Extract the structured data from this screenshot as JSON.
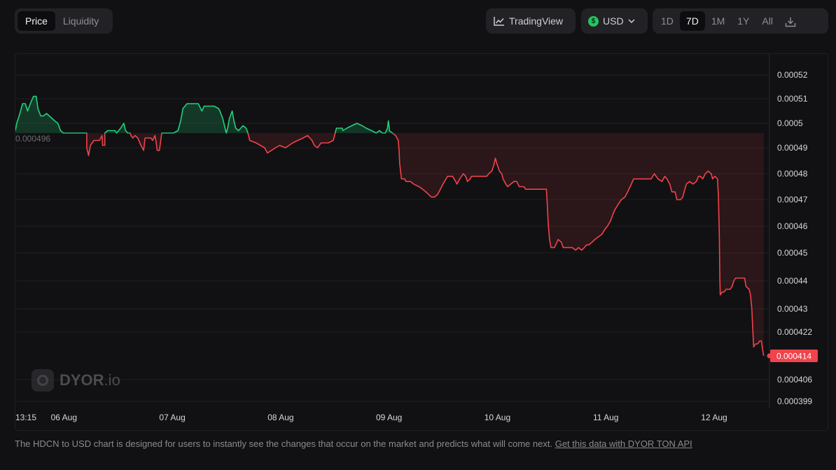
{
  "toolbar": {
    "tabs": [
      {
        "label": "Price",
        "active": true
      },
      {
        "label": "Liquidity",
        "active": false
      }
    ],
    "tradingview_label": "TradingView",
    "currency": {
      "label": "USD",
      "icon": "$"
    },
    "ranges": [
      {
        "label": "1D"
      },
      {
        "label": "7D",
        "active": true
      },
      {
        "label": "1M"
      },
      {
        "label": "1Y"
      },
      {
        "label": "All"
      }
    ],
    "download_icon": "download-icon"
  },
  "watermark": {
    "brand": "DYOR",
    ".suffix": ".io",
    "suffix": ".io"
  },
  "footer": {
    "text": "The HDCN to USD chart is designed for users to instantly see the changes that occur on the market and predicts what will come next. ",
    "link": "Get this data with DYOR TON API"
  },
  "colors": {
    "up": "#22d17a",
    "down": "#f0434b",
    "grid": "#1e1e22",
    "axis_text": "#d8d8dc",
    "baseline_text": "#6b6b72"
  },
  "chart_data": {
    "type": "line",
    "baseline": 0.000496,
    "baseline_label": "0.000496",
    "last_value": 0.000414,
    "last_label": "0.000414",
    "y_ticks": [
      {
        "label": "0.00052",
        "v": 0.00052
      },
      {
        "label": "0.00051",
        "v": 0.00051
      },
      {
        "label": "0.0005",
        "v": 0.0005
      },
      {
        "label": "0.00049",
        "v": 0.00049
      },
      {
        "label": "0.00048",
        "v": 0.00048
      },
      {
        "label": "0.00047",
        "v": 0.00047
      },
      {
        "label": "0.00046",
        "v": 0.00046
      },
      {
        "label": "0.00045",
        "v": 0.00045
      },
      {
        "label": "0.00044",
        "v": 0.00044
      },
      {
        "label": "0.00043",
        "v": 0.00043
      },
      {
        "label": "0.000422",
        "v": 0.000422
      },
      {
        "label": "0.000406",
        "v": 0.000406
      },
      {
        "label": "0.000399",
        "v": 0.000399
      }
    ],
    "x_ticks": [
      {
        "label": "13:15",
        "t": 0
      },
      {
        "label": "06 Aug",
        "t": 10.75
      },
      {
        "label": "07 Aug",
        "t": 34.75
      },
      {
        "label": "08 Aug",
        "t": 58.75
      },
      {
        "label": "09 Aug",
        "t": 82.75
      },
      {
        "label": "10 Aug",
        "t": 106.75
      },
      {
        "label": "11 Aug",
        "t": 130.75
      },
      {
        "label": "12 Aug",
        "t": 154.75
      }
    ],
    "x_range_hours": [
      0,
      167
    ],
    "series": [
      {
        "points": [
          [
            0,
            0.000497
          ],
          [
            0.3,
            0.0005
          ],
          [
            1,
            0.000504
          ],
          [
            1.6,
            0.000508
          ],
          [
            2.2,
            0.000508
          ],
          [
            2.7,
            0.000505
          ],
          [
            3.3,
            0.000508
          ],
          [
            4,
            0.000511
          ],
          [
            4.6,
            0.000511
          ],
          [
            5,
            0.000506
          ],
          [
            5.6,
            0.000503
          ],
          [
            6.2,
            0.000503
          ],
          [
            6.9,
            0.000504
          ],
          [
            7.5,
            0.000503
          ],
          [
            8.1,
            0.000502
          ],
          [
            8.7,
            0.000501
          ],
          [
            9.4,
            0.0005
          ],
          [
            10,
            0.000497
          ],
          [
            10.6,
            0.000496
          ],
          [
            11.4,
            0.000496
          ],
          [
            12.3,
            0.000496
          ],
          [
            15.8,
            0.000496
          ],
          [
            15.8,
            0.00049
          ],
          [
            16.2,
            0.000487
          ],
          [
            16.6,
            0.000491
          ],
          [
            17.4,
            0.000493
          ],
          [
            18.6,
            0.000493
          ],
          [
            19.2,
            0.000495
          ],
          [
            19.3,
            0.000491
          ],
          [
            19.8,
            0.000491
          ],
          [
            19.8,
            0.000496
          ],
          [
            20.4,
            0.000497
          ],
          [
            21.5,
            0.000497
          ],
          [
            22.1,
            0.000497
          ],
          [
            22.4,
            0.000496
          ],
          [
            23.3,
            0.000498
          ],
          [
            24,
            0.0005
          ],
          [
            24.4,
            0.000497
          ],
          [
            24.9,
            0.000496
          ],
          [
            25.4,
            0.000496
          ],
          [
            25.6,
            0.000495
          ],
          [
            26,
            0.000494
          ],
          [
            26.5,
            0.000495
          ],
          [
            27.1,
            0.000494
          ],
          [
            27.8,
            0.000491
          ],
          [
            28.4,
            0.000489
          ],
          [
            28.7,
            0.000494
          ],
          [
            30,
            0.000494
          ],
          [
            30.4,
            0.000493
          ],
          [
            30.9,
            0.000495
          ],
          [
            31.2,
            0.000492
          ],
          [
            31.4,
            0.000489
          ],
          [
            31.9,
            0.000489
          ],
          [
            32.4,
            0.000496
          ],
          [
            33.5,
            0.000496
          ],
          [
            35,
            0.000496
          ],
          [
            36,
            0.000497
          ],
          [
            36.6,
            0.000501
          ],
          [
            37.1,
            0.000506
          ],
          [
            38,
            0.000508
          ],
          [
            38.5,
            0.000508
          ],
          [
            39.8,
            0.000508
          ],
          [
            40.5,
            0.000508
          ],
          [
            41.3,
            0.000505
          ],
          [
            41.8,
            0.000507
          ],
          [
            43,
            0.000507
          ],
          [
            44,
            0.000507
          ],
          [
            45,
            0.000506
          ],
          [
            45.3,
            0.000505
          ],
          [
            45.9,
            0.000502
          ],
          [
            46.3,
            0.000499
          ],
          [
            46.7,
            0.000496
          ],
          [
            47,
            0.000498
          ],
          [
            47.4,
            0.000502
          ],
          [
            48,
            0.000505
          ],
          [
            48.4,
            0.000501
          ],
          [
            48.8,
            0.000498
          ],
          [
            49.4,
            0.000497
          ],
          [
            50.4,
            0.000499
          ],
          [
            51.1,
            0.000498
          ],
          [
            51.5,
            0.000496
          ],
          [
            51.9,
            0.000493
          ],
          [
            53.3,
            0.000492
          ],
          [
            55.2,
            0.00049
          ],
          [
            55.8,
            0.000488
          ],
          [
            57.6,
            0.00049
          ],
          [
            58.5,
            0.000491
          ],
          [
            59.8,
            0.00049
          ],
          [
            60.6,
            0.000491
          ],
          [
            61.4,
            0.000492
          ],
          [
            62.5,
            0.000493
          ],
          [
            63.7,
            0.000494
          ],
          [
            64.7,
            0.000495
          ],
          [
            65.2,
            0.000494
          ],
          [
            65.7,
            0.000493
          ],
          [
            66.2,
            0.000491
          ],
          [
            66.9,
            0.00049
          ],
          [
            67.7,
            0.000492
          ],
          [
            69.3,
            0.000492
          ],
          [
            70.4,
            0.000493
          ],
          [
            71.1,
            0.000498
          ],
          [
            72.4,
            0.000498
          ],
          [
            72.5,
            0.000497
          ],
          [
            73.4,
            0.000498
          ],
          [
            74.5,
            0.000499
          ],
          [
            75.6,
            0.0005
          ],
          [
            76.8,
            0.000499
          ],
          [
            77.7,
            0.000498
          ],
          [
            78.9,
            0.000497
          ],
          [
            79.9,
            0.000496
          ],
          [
            80.6,
            0.000497
          ],
          [
            81.3,
            0.000496
          ],
          [
            81.9,
            0.000496
          ],
          [
            82.4,
            0.000498
          ],
          [
            82.6,
            0.000501
          ],
          [
            82.8,
            0.000498
          ],
          [
            82.8,
            0.000497
          ],
          [
            83.5,
            0.000496
          ],
          [
            84.2,
            0.000495
          ],
          [
            84.8,
            0.000493
          ],
          [
            85,
            0.000488
          ],
          [
            85.1,
            0.000484
          ],
          [
            85.5,
            0.000478
          ],
          [
            86.2,
            0.000478
          ],
          [
            86.5,
            0.000477
          ],
          [
            87.5,
            0.000477
          ],
          [
            88.2,
            0.000476
          ],
          [
            89.4,
            0.000475
          ],
          [
            90.2,
            0.000474
          ],
          [
            90.9,
            0.000473
          ],
          [
            91.5,
            0.000472
          ],
          [
            92.1,
            0.000471
          ],
          [
            92.8,
            0.000471
          ],
          [
            93.5,
            0.000472
          ],
          [
            94.1,
            0.000474
          ],
          [
            94.7,
            0.000476
          ],
          [
            95.7,
            0.000479
          ],
          [
            96.8,
            0.000479
          ],
          [
            97.5,
            0.000477
          ],
          [
            97.8,
            0.000476
          ],
          [
            98.4,
            0.000478
          ],
          [
            99.2,
            0.00048
          ],
          [
            99.7,
            0.000479
          ],
          [
            100.1,
            0.000477
          ],
          [
            100.7,
            0.000478
          ],
          [
            101,
            0.000479
          ],
          [
            102,
            0.000479
          ],
          [
            103.5,
            0.000479
          ],
          [
            104.4,
            0.000479
          ],
          [
            104.8,
            0.00048
          ],
          [
            105.5,
            0.000481
          ],
          [
            105.9,
            0.000483
          ],
          [
            106.3,
            0.000486
          ],
          [
            106.6,
            0.000484
          ],
          [
            107.2,
            0.000481
          ],
          [
            107.7,
            0.00048
          ],
          [
            108,
            0.000478
          ],
          [
            108.6,
            0.000476
          ],
          [
            109,
            0.000475
          ],
          [
            109.7,
            0.000476
          ],
          [
            110.4,
            0.000477
          ],
          [
            111,
            0.000477
          ],
          [
            111.6,
            0.000475
          ],
          [
            112,
            0.000475
          ],
          [
            112.6,
            0.000475
          ],
          [
            113,
            0.000474
          ],
          [
            113.6,
            0.000474
          ],
          [
            114.6,
            0.000474
          ],
          [
            115.6,
            0.000474
          ],
          [
            116.5,
            0.000474
          ],
          [
            117,
            0.000474
          ],
          [
            117.6,
            0.000474
          ],
          [
            117.8,
            0.000468
          ],
          [
            118,
            0.000461
          ],
          [
            118.3,
            0.000455
          ],
          [
            118.6,
            0.000452
          ],
          [
            119.4,
            0.000452
          ],
          [
            120.2,
            0.000455
          ],
          [
            120.9,
            0.000454
          ],
          [
            121.3,
            0.000452
          ],
          [
            122.4,
            0.000452
          ],
          [
            123.3,
            0.000452
          ],
          [
            124.1,
            0.000451
          ],
          [
            124.7,
            0.000452
          ],
          [
            125.4,
            0.000451
          ],
          [
            126,
            0.000452
          ],
          [
            126.5,
            0.000453
          ],
          [
            127,
            0.000453
          ],
          [
            127.7,
            0.000454
          ],
          [
            128.3,
            0.000455
          ],
          [
            129.1,
            0.000456
          ],
          [
            129.9,
            0.000457
          ],
          [
            130.6,
            0.000459
          ],
          [
            131.1,
            0.00046
          ],
          [
            131.8,
            0.000462
          ],
          [
            132.2,
            0.000464
          ],
          [
            132.7,
            0.000466
          ],
          [
            133.4,
            0.000468
          ],
          [
            134.2,
            0.00047
          ],
          [
            135,
            0.000471
          ],
          [
            135.6,
            0.000473
          ],
          [
            136.4,
            0.000476
          ],
          [
            136.9,
            0.000478
          ],
          [
            137.8,
            0.000478
          ],
          [
            138.7,
            0.000478
          ],
          [
            139.8,
            0.000478
          ],
          [
            140.2,
            0.000478
          ],
          [
            140.8,
            0.000478
          ],
          [
            141.5,
            0.00048
          ],
          [
            142.3,
            0.000478
          ],
          [
            143.2,
            0.000477
          ],
          [
            143.8,
            0.000479
          ],
          [
            144.3,
            0.000478
          ],
          [
            144.9,
            0.000476
          ],
          [
            145.4,
            0.000473
          ],
          [
            146.1,
            0.000473
          ],
          [
            146.5,
            0.00047
          ],
          [
            147.3,
            0.00047
          ],
          [
            147.8,
            0.000471
          ],
          [
            148.1,
            0.000473
          ],
          [
            148.6,
            0.000476
          ],
          [
            149.3,
            0.000477
          ],
          [
            150.1,
            0.000476
          ],
          [
            150.8,
            0.000477
          ],
          [
            151.3,
            0.000479
          ],
          [
            151.7,
            0.000479
          ],
          [
            152.2,
            0.000478
          ],
          [
            152.8,
            0.00048
          ],
          [
            153.4,
            0.000481
          ],
          [
            154.1,
            0.00048
          ],
          [
            154.4,
            0.000478
          ],
          [
            154.9,
            0.000479
          ],
          [
            155.5,
            0.000478
          ],
          [
            155.7,
            0.000471
          ],
          [
            155.9,
            0.000456
          ],
          [
            156,
            0.000441
          ],
          [
            156.1,
            0.000435
          ],
          [
            156.5,
            0.000436
          ],
          [
            156.9,
            0.000436
          ],
          [
            157.4,
            0.000437
          ],
          [
            158,
            0.000437
          ],
          [
            158.3,
            0.000437
          ],
          [
            158.7,
            0.000438
          ],
          [
            159.1,
            0.00044
          ],
          [
            159.5,
            0.000441
          ],
          [
            160.1,
            0.000441
          ],
          [
            161.5,
            0.000441
          ],
          [
            161.8,
            0.000438
          ],
          [
            162.5,
            0.000437
          ],
          [
            162.8,
            0.000435
          ],
          [
            163.1,
            0.00043
          ],
          [
            163.3,
            0.000423
          ],
          [
            163.5,
            0.000417
          ],
          [
            163.9,
            0.000418
          ],
          [
            164.4,
            0.000418
          ],
          [
            164.8,
            0.000419
          ],
          [
            165.2,
            0.000419
          ],
          [
            165.5,
            0.000416
          ],
          [
            165.7,
            0.000414
          ]
        ]
      }
    ]
  }
}
